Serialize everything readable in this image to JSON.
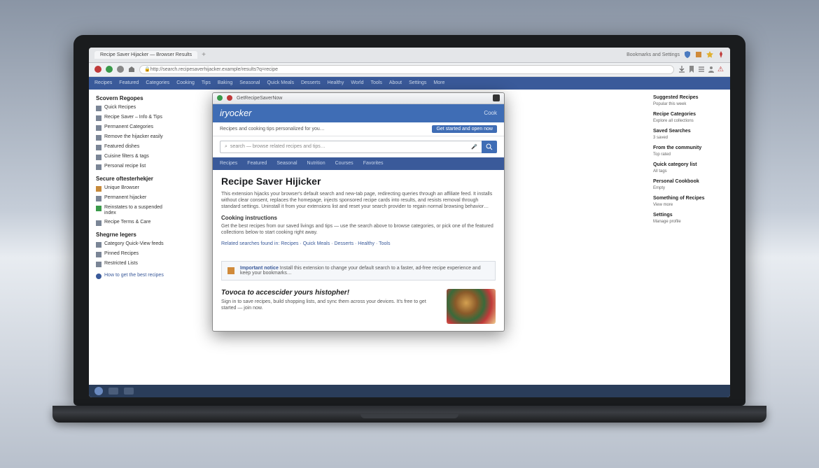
{
  "browser": {
    "tab_title": "Recipe Saver Hijacker — Browser Results",
    "address": "http://search.recipesaverhijacker.example/results?q=recipe",
    "right_label": "Bookmarks and Settings",
    "nav_items": [
      "Recipes",
      "Featured",
      "Categories",
      "Cooking",
      "Tips",
      "Baking",
      "Seasonal",
      "Quick Meals",
      "Desserts",
      "Healthy",
      "World",
      "Tools",
      "About",
      "Settings",
      "More"
    ]
  },
  "left_sidebar": {
    "heading1": "Scovern Regopes",
    "items1": [
      "Quick Recipes",
      "Recipe Saver – Info & Tips",
      "Permanent Categories",
      "Remove the hijacker easily",
      "Featured dishes",
      "Cuisine filters & tags",
      "Personal recipe list"
    ],
    "heading2": "Secure oftesterhekjer",
    "items2": [
      "Unique Browser",
      "Permanent hijacker",
      "Reinstates to a suspended index",
      "Recipe Terms & Care"
    ],
    "heading3": "Shegrne legers",
    "items3": [
      "Category Quick-View feeds",
      "Pinned Recipes",
      "Restricted Lists"
    ],
    "footer_note": "How to get the best recipes"
  },
  "popup": {
    "titlebar": "GetRecipeSaverNow",
    "brand": "iryocker",
    "cook_label": "Cook",
    "subtitle": "Recipes and cooking tips personalized for you…",
    "cta": "Get started and open now",
    "search_placeholder": "search — browse related recipes and tips…",
    "tabs": [
      "Recipes",
      "Featured",
      "Seasonal",
      "Nutrition",
      "Courses",
      "Favorites"
    ],
    "article_title": "Recipe Saver Hijicker",
    "article_body": "This extension hijacks your browser's default search and new-tab page, redirecting queries through an affiliate feed. It installs without clear consent, replaces the homepage, injects sponsored recipe cards into results, and resists removal through standard settings. Uninstall it from your extensions list and reset your search provider to regain normal browsing behavior…",
    "sub_heading": "Cooking instructions",
    "sub_body": "Get the best recipes from our saved livings and tips — use the search above to browse categories, or pick one of the featured collections below to start cooking right away.",
    "links_label": "Related searches found in: Recipes · Quick Meals · Desserts · Healthy · Tools",
    "callout_title": "Important notice",
    "callout_body": "Install this extension to change your default search to a faster, ad-free recipe experience and keep your bookmarks…",
    "section_title": "Tovoca to accescider yours histopher!",
    "section_body": "Sign in to save recipes, build shopping lists, and sync them across your devices. It's free to get started — join now."
  },
  "right_sidebar": {
    "items": [
      {
        "title": "Suggested Recipes",
        "sub": "Popular this week"
      },
      {
        "title": "Recipe Categories",
        "sub": "Explore all collections"
      },
      {
        "title": "Saved Searches",
        "sub": "3 saved"
      },
      {
        "title": "From the community",
        "sub": "Top rated"
      },
      {
        "title": "Quick category list",
        "sub": "All tags"
      },
      {
        "title": "Personal Cookbook",
        "sub": "Empty"
      },
      {
        "title": "Something of Recipes",
        "sub": "View more"
      },
      {
        "title": "Settings",
        "sub": "Manage profile"
      }
    ]
  }
}
